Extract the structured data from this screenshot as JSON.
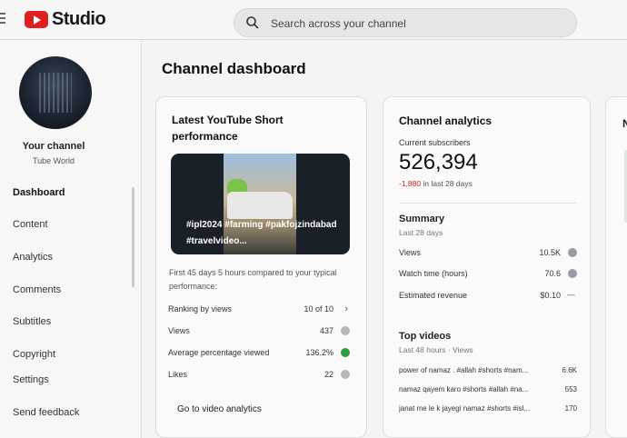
{
  "app": {
    "logo_text": "Studio",
    "search_placeholder": "Search across your channel"
  },
  "sidebar": {
    "your_channel": "Your channel",
    "channel_name": "Tube World",
    "items": [
      {
        "label": "Dashboard",
        "active": true
      },
      {
        "label": "Content"
      },
      {
        "label": "Analytics"
      },
      {
        "label": "Comments"
      },
      {
        "label": "Subtitles"
      },
      {
        "label": "Copyright"
      },
      {
        "label": "Settings"
      },
      {
        "label": "Send feedback"
      }
    ]
  },
  "main": {
    "page_title": "Channel dashboard",
    "latest_short": {
      "title": "Latest YouTube Short performance",
      "thumbnail_caption": "#ipl2024 #farming #pakfojzindabad #travelvideo...",
      "comparison_text": "First 45 days 5 hours compared to your typical performance:",
      "rows": [
        {
          "label": "Ranking by views",
          "value": "10 of 10"
        },
        {
          "label": "Views",
          "value": "437"
        },
        {
          "label": "Average percentage viewed",
          "value": "136.2%"
        },
        {
          "label": "Likes",
          "value": "22"
        }
      ],
      "link": "Go to video analytics"
    },
    "channel_analytics": {
      "title": "Channel analytics",
      "subscribers_label": "Current subscribers",
      "subscribers_value": "526,394",
      "subscribers_change": "-1,880",
      "subscribers_change_period": "in last 28 days",
      "summary": {
        "title": "Summary",
        "period": "Last 28 days",
        "rows": [
          {
            "label": "Views",
            "value": "10.5K"
          },
          {
            "label": "Watch time (hours)",
            "value": "70.6"
          },
          {
            "label": "Estimated revenue",
            "value": "$0.10"
          }
        ]
      },
      "top_videos": {
        "title": "Top videos",
        "period": "Last 48 hours · Views",
        "rows": [
          {
            "label": "power of namaz . #allah #shorts #nam...",
            "value": "6.6K"
          },
          {
            "label": "namaz qayem karo #shorts #allah #na...",
            "value": "553"
          },
          {
            "label": "janat me le k jayegi namaz #shorts #isl...",
            "value": "170"
          }
        ]
      }
    },
    "third_card": {
      "letter": "N"
    }
  },
  "colors": {
    "brand_red": "#e02020",
    "negative": "#cc2222",
    "positive_green": "#2e9e3e"
  }
}
